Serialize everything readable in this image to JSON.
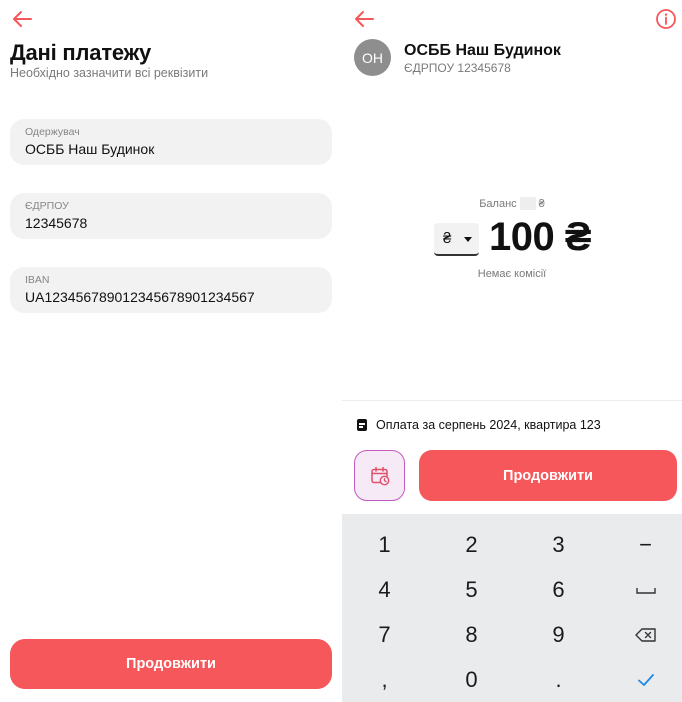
{
  "colors": {
    "accent": "#f5575a",
    "field_bg": "#f2f2f2",
    "keypad_bg": "#eaebed",
    "schedule_border": "#c35ac2"
  },
  "left": {
    "back_icon": "arrow-left-icon",
    "title": "Дані платежу",
    "subtitle": "Необхідно зазначити всі реквізити",
    "fields": [
      {
        "label": "Одержувач",
        "value": "ОСББ Наш Будинок"
      },
      {
        "label": "ЄДРПОУ",
        "value": "12345678"
      },
      {
        "label": "IBAN",
        "value": "UA12345678901234567890123456​7"
      }
    ],
    "continue_label": "Продовжити"
  },
  "right": {
    "back_icon": "arrow-left-icon",
    "info_icon": "info-icon",
    "avatar_initials": "ОН",
    "payee_name": "ОСББ Наш Будинок",
    "payee_code": "ЄДРПОУ 12345678",
    "balance_label": "Баланс",
    "balance_currency": "₴",
    "currency": "₴",
    "amount": "100 ₴",
    "commission": "Немає комісії",
    "purpose": "Оплата за серпень 2024, квартира 123",
    "continue_label": "Продовжити",
    "schedule_icon": "calendar-repeat-icon",
    "keypad": {
      "keys": [
        "1",
        "2",
        "3",
        "−",
        "4",
        "5",
        "6",
        "␣",
        "7",
        "8",
        "9",
        "⌫",
        ",",
        "0",
        ".",
        "✓"
      ]
    }
  }
}
